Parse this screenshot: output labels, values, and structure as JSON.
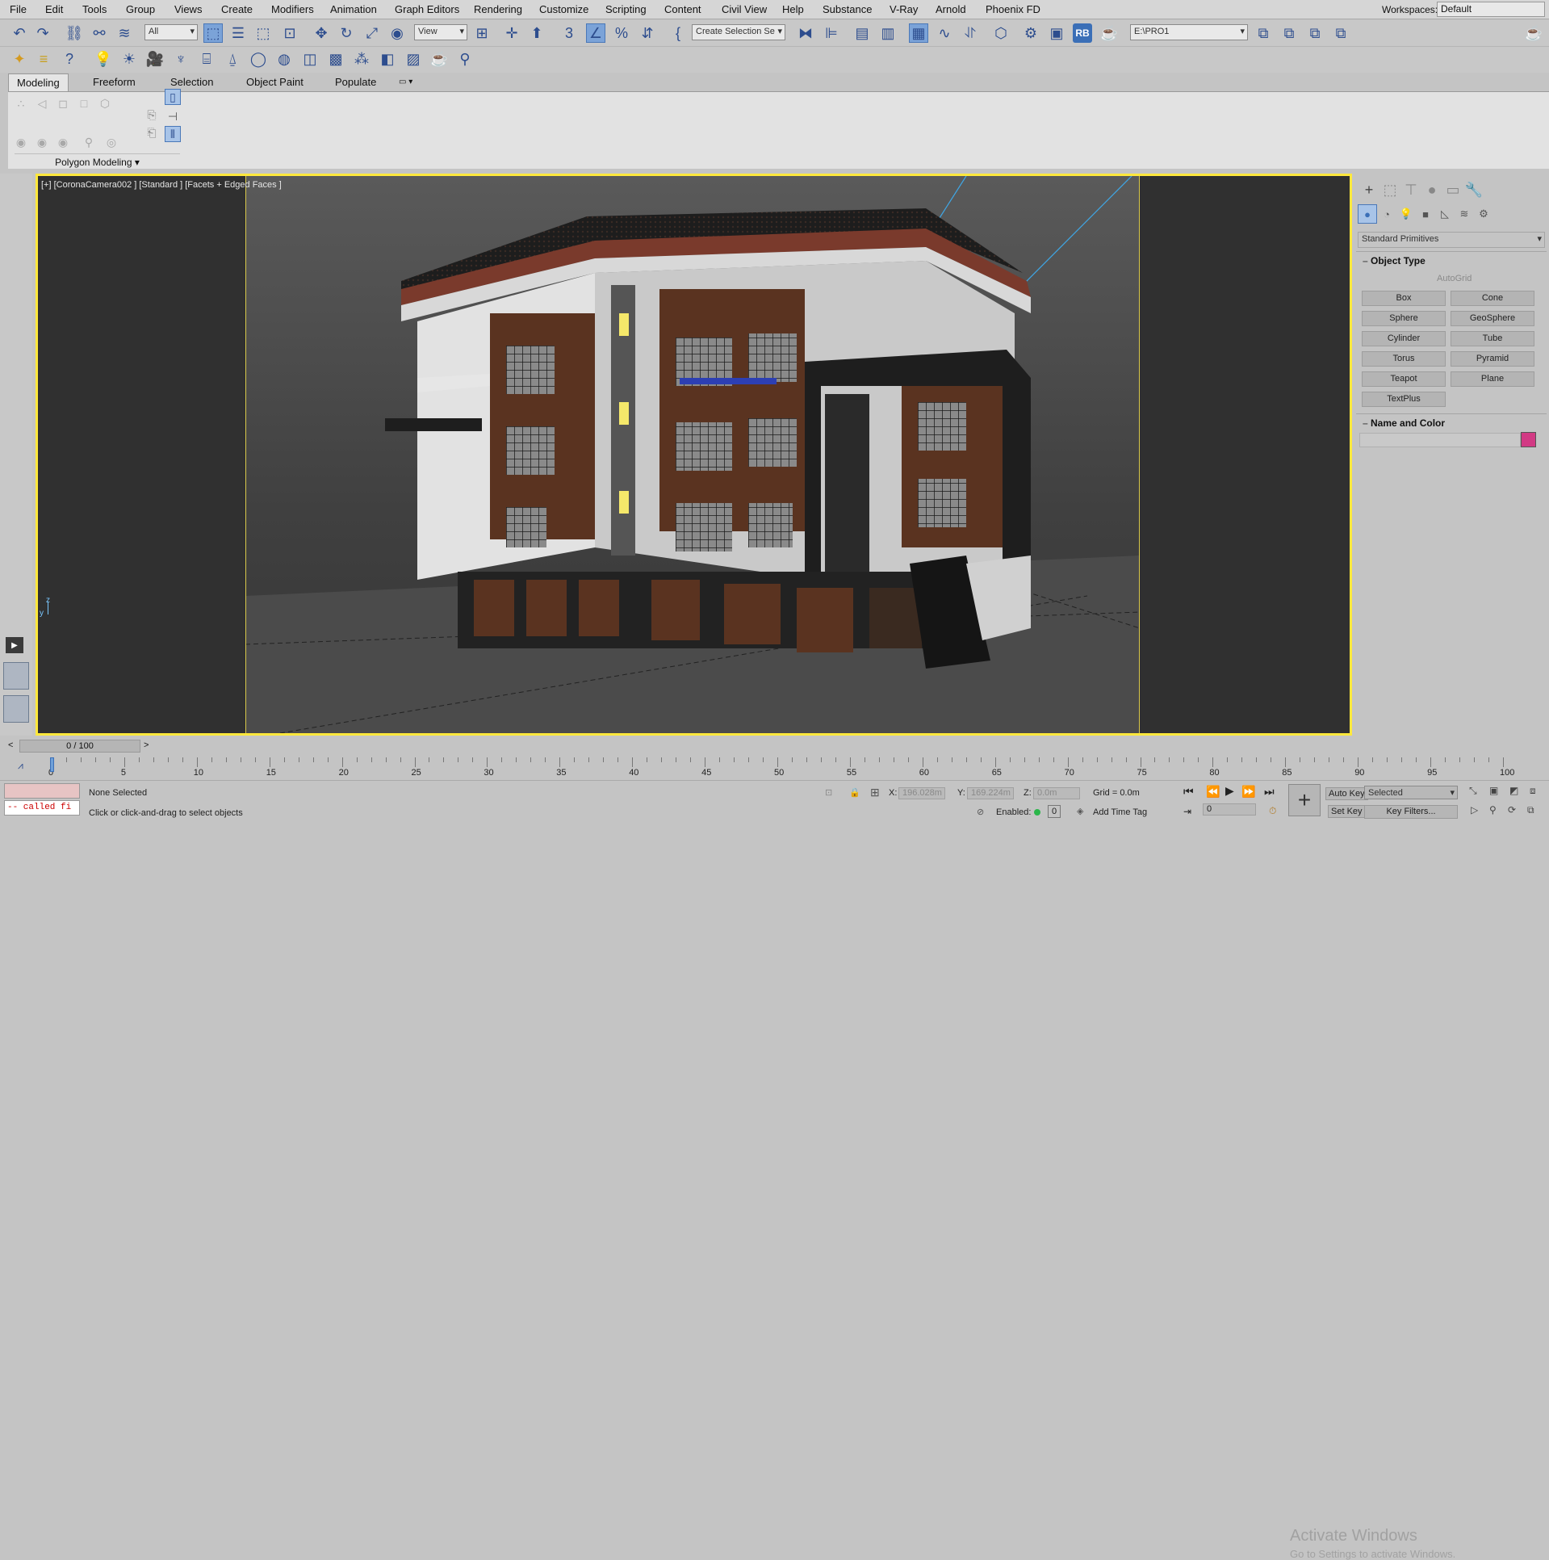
{
  "menu": [
    "File",
    "Edit",
    "Tools",
    "Group",
    "Views",
    "Create",
    "Modifiers",
    "Animation",
    "Graph Editors",
    "Rendering",
    "Customize",
    "Scripting",
    "Content",
    "Civil View",
    "Help",
    "Substance",
    "V-Ray",
    "Arnold",
    "Phoenix FD"
  ],
  "workspace": {
    "label": "Workspaces:",
    "value": "Default"
  },
  "toolbar": {
    "filter_value": "All",
    "ref_coord_value": "View",
    "selection_set_placeholder": "Create Selection Se",
    "rb_label": "RB",
    "project_path": "E:\\PRO1"
  },
  "ribbon": {
    "tabs": [
      "Modeling",
      "Freeform",
      "Selection",
      "Object Paint",
      "Populate"
    ],
    "active_tab": "Modeling",
    "panel_label": "Polygon Modeling"
  },
  "viewport": {
    "label": "[+] [CoronaCamera002 ] [Standard ] [Facets + Edged Faces ]",
    "axis_y": "z",
    "axis_x": "y"
  },
  "command_panel": {
    "category": "Standard Primitives",
    "object_type_title": "Object Type",
    "autogrid_label": "AutoGrid",
    "buttons": [
      "Box",
      "Cone",
      "Sphere",
      "GeoSphere",
      "Cylinder",
      "Tube",
      "Torus",
      "Pyramid",
      "Teapot",
      "Plane",
      "TextPlus"
    ],
    "name_color_title": "Name and Color",
    "object_color": "#d23a84"
  },
  "timeslider": {
    "frame_display": "0 / 100",
    "current_frame": 0,
    "total_frames": 100
  },
  "timeline": {
    "ticks": [
      "0",
      "5",
      "10",
      "15",
      "20",
      "25",
      "30",
      "35",
      "40",
      "45",
      "50",
      "55",
      "60",
      "65",
      "70",
      "75",
      "80",
      "85",
      "90",
      "95",
      "100"
    ]
  },
  "status": {
    "selection": "None Selected",
    "prompt": "Click or click-and-drag to select objects",
    "script_text": "-- called fi",
    "x_label": "X:",
    "x_value": "196.028m",
    "y_label": "Y:",
    "y_value": "169.224m",
    "z_label": "Z:",
    "z_value": "0.0m",
    "grid": "Grid = 0.0m",
    "enabled_label": "Enabled:",
    "enabled_count": "0",
    "add_time_tag": "Add Time Tag",
    "auto_key": "Auto Key",
    "key_mode": "Selected",
    "set_key": "Set Key",
    "key_filters": "Key Filters...",
    "frame_value": "0"
  },
  "watermark": {
    "line1": "Activate Windows",
    "line2": "Go to Settings to activate Windows."
  },
  "colors": {
    "viewport_border": "#ffe83c",
    "accent": "#3b6fb7"
  }
}
